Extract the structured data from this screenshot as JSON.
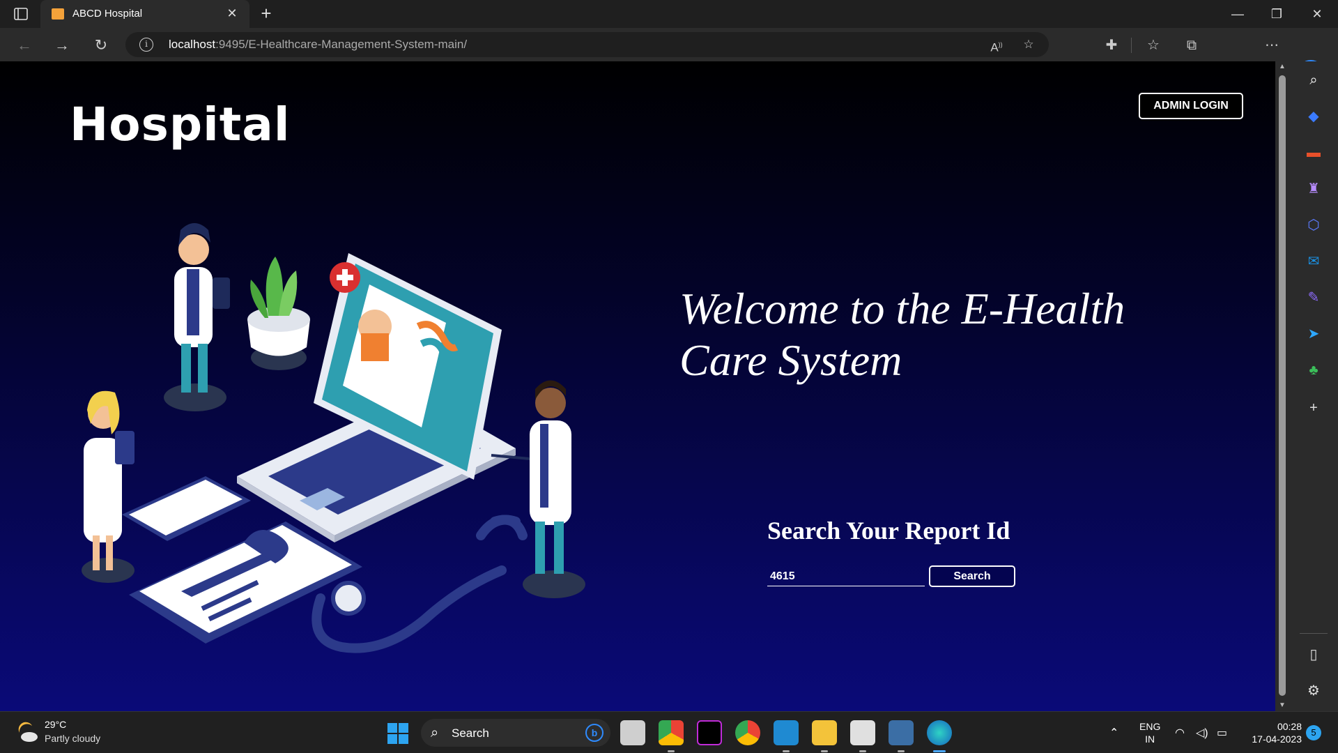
{
  "browser": {
    "tab_title": "ABCD Hospital",
    "url_host": "localhost",
    "url_rest": ":9495/E-Healthcare-Management-System-main/"
  },
  "page": {
    "logo": "Hospital",
    "admin_button": "ADMIN LOGIN",
    "welcome_line1": "Welcome to the E-Health",
    "welcome_line2": "Care System",
    "search_title": "Search Your Report Id",
    "report_id_value": "4615",
    "search_button": "Search"
  },
  "taskbar": {
    "temperature": "29°C",
    "weather": "Partly cloudy",
    "search_label": "Search",
    "lang_top": "ENG",
    "lang_bottom": "IN",
    "time": "00:28",
    "date": "17-04-2023",
    "notification_count": "5"
  },
  "colors": {
    "page_gradient_top": "#000000",
    "page_gradient_bottom": "#0a0a78",
    "accent_blue": "#2e8bff"
  }
}
